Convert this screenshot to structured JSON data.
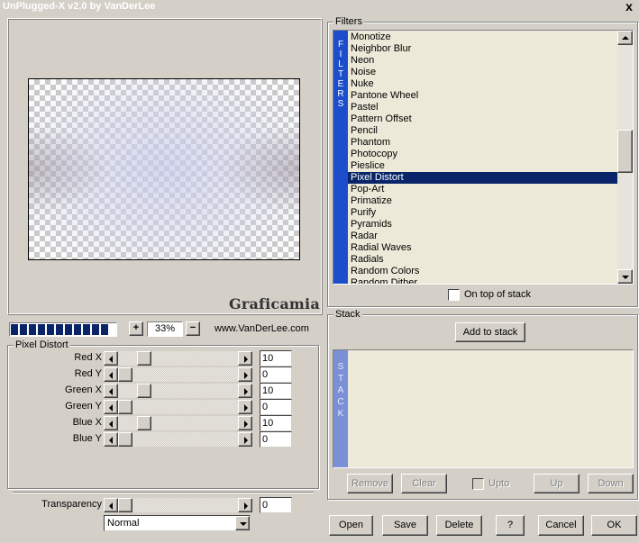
{
  "window": {
    "title": "UnPlugged-X v2.0 by VanDerLee",
    "close_glyph": "x"
  },
  "preview": {
    "watermark": "Graficamia",
    "progress_blocks": 11,
    "zoom_plus": "+",
    "zoom_minus": "−",
    "zoom_value": "33%",
    "url": "www.VanDerLee.com"
  },
  "settings": {
    "group_label": "Pixel Distort",
    "sliders": [
      {
        "label": "Red X",
        "value": "10",
        "thumb_fraction": 0.18
      },
      {
        "label": "Red Y",
        "value": "0",
        "thumb_fraction": 0.0
      },
      {
        "label": "Green X",
        "value": "10",
        "thumb_fraction": 0.18
      },
      {
        "label": "Green Y",
        "value": "0",
        "thumb_fraction": 0.0
      },
      {
        "label": "Blue X",
        "value": "10",
        "thumb_fraction": 0.18
      },
      {
        "label": "Blue Y",
        "value": "0",
        "thumb_fraction": 0.0
      }
    ],
    "transparency": {
      "label": "Transparency",
      "value": "0",
      "thumb_fraction": 0.0
    },
    "blend_mode": "Normal"
  },
  "filters": {
    "group_label": "Filters",
    "tab_text": "FILTERS",
    "items": [
      "Monotize",
      "Neighbor Blur",
      "Neon",
      "Noise",
      "Nuke",
      "Pantone Wheel",
      "Pastel",
      "Pattern Offset",
      "Pencil",
      "Phantom",
      "Photocopy",
      "Pieslice",
      "Pixel Distort",
      "Pop-Art",
      "Primatize",
      "Purify",
      "Pyramids",
      "Radar",
      "Radial Waves",
      "Radials",
      "Random Colors",
      "Random Dither"
    ],
    "selected_index": 12,
    "on_top_label": "On top of stack"
  },
  "stack": {
    "group_label": "Stack",
    "add_label": "Add to stack",
    "tab_text": "STACK",
    "remove_label": "Remove",
    "clear_label": "Clear",
    "upto_label": "Upto",
    "up_label": "Up",
    "down_label": "Down"
  },
  "bottom_buttons": {
    "open": "Open",
    "save": "Save",
    "delete": "Delete",
    "help": "?",
    "cancel": "Cancel",
    "ok": "OK"
  },
  "colors": {
    "face": "#d4d0c8",
    "selection": "#0a246a",
    "filters_tab": "#1c4ecc",
    "stack_tab": "#7b8fd6",
    "list_bg": "#ece9d8"
  }
}
